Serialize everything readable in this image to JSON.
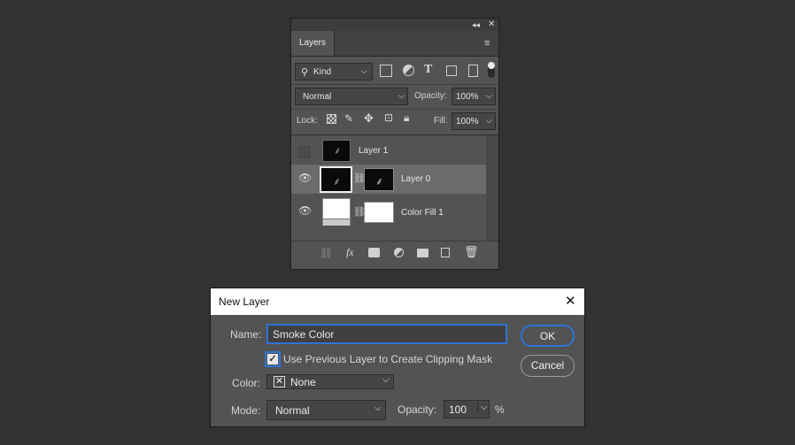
{
  "layers_panel": {
    "tab": "Layers",
    "filter": {
      "kind_label": "Kind"
    },
    "blend_mode": "Normal",
    "opacity_label": "Opacity:",
    "opacity_value": "100%",
    "lock_label": "Lock:",
    "fill_label": "Fill:",
    "fill_value": "100%",
    "layers": [
      {
        "name": "Layer 1",
        "visible": false
      },
      {
        "name": "Layer 0",
        "visible": true,
        "selected": true
      },
      {
        "name": "Color Fill 1",
        "visible": true
      }
    ],
    "footer_icons": [
      "link-icon",
      "fx-icon",
      "mask-icon",
      "adjustment-icon",
      "group-folder-icon",
      "new-layer-icon",
      "trash-icon"
    ]
  },
  "dialog": {
    "title": "New Layer",
    "name_label": "Name:",
    "name_value": "Smoke Color",
    "clip_label": "Use Previous Layer to Create Clipping Mask",
    "clip_checked": true,
    "color_label": "Color:",
    "color_value": "None",
    "mode_label": "Mode:",
    "mode_value": "Normal",
    "opacity_label": "Opacity:",
    "opacity_value": "100",
    "percent": "%",
    "ok_label": "OK",
    "cancel_label": "Cancel"
  },
  "colors": {
    "accent": "#2f73d8",
    "background": "#323232",
    "panel": "#535353"
  }
}
